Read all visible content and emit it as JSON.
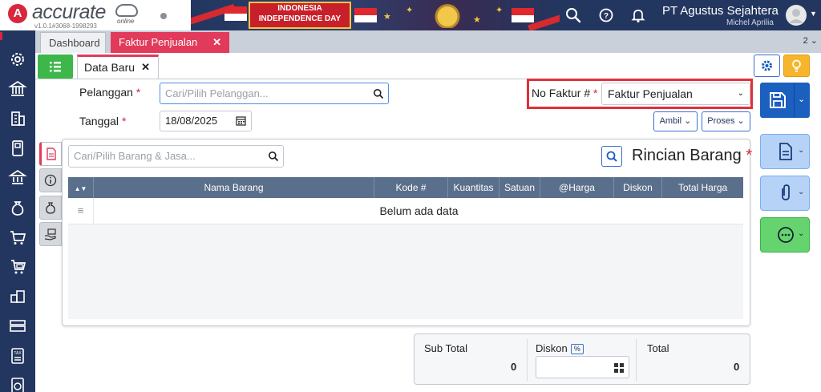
{
  "header": {
    "logo_text": "accurate",
    "logo_sub": "online",
    "version": "v1.0.1#3068-1998293",
    "banner_line1": "INDONESIA",
    "banner_line2": "INDEPENDENCE DAY",
    "company": "PT Agustus Sejahtera",
    "user": "Michel Aprilia"
  },
  "tabs": {
    "dashboard": "Dashboard",
    "faktur": "Faktur Penjualan",
    "count": "2"
  },
  "subtab": {
    "label": "Data Baru"
  },
  "form": {
    "pelanggan_label": "Pelanggan",
    "pelanggan_placeholder": "Cari/Pilih Pelanggan...",
    "tanggal_label": "Tanggal",
    "tanggal_value": "18/08/2025",
    "no_faktur_label": "No Faktur #",
    "no_faktur_value": "Faktur Penjualan",
    "required_mark": "*",
    "ambil_label": "Ambil",
    "proses_label": "Proses"
  },
  "detail": {
    "search_placeholder": "Cari/Pilih Barang & Jasa...",
    "title": "Rincian Barang",
    "columns": [
      "Nama Barang",
      "Kode #",
      "Kuantitas",
      "Satuan",
      "@Harga",
      "Diskon",
      "Total Harga"
    ],
    "empty_message": "Belum ada data"
  },
  "totals": {
    "sub_total_label": "Sub Total",
    "sub_total_value": "0",
    "diskon_label": "Diskon",
    "diskon_unit": "%",
    "total_label": "Total",
    "total_value": "0"
  },
  "colors": {
    "navy": "#23365f",
    "accent_red": "#e23a5a",
    "primary_blue": "#1b5fbf",
    "green": "#3db74a"
  }
}
